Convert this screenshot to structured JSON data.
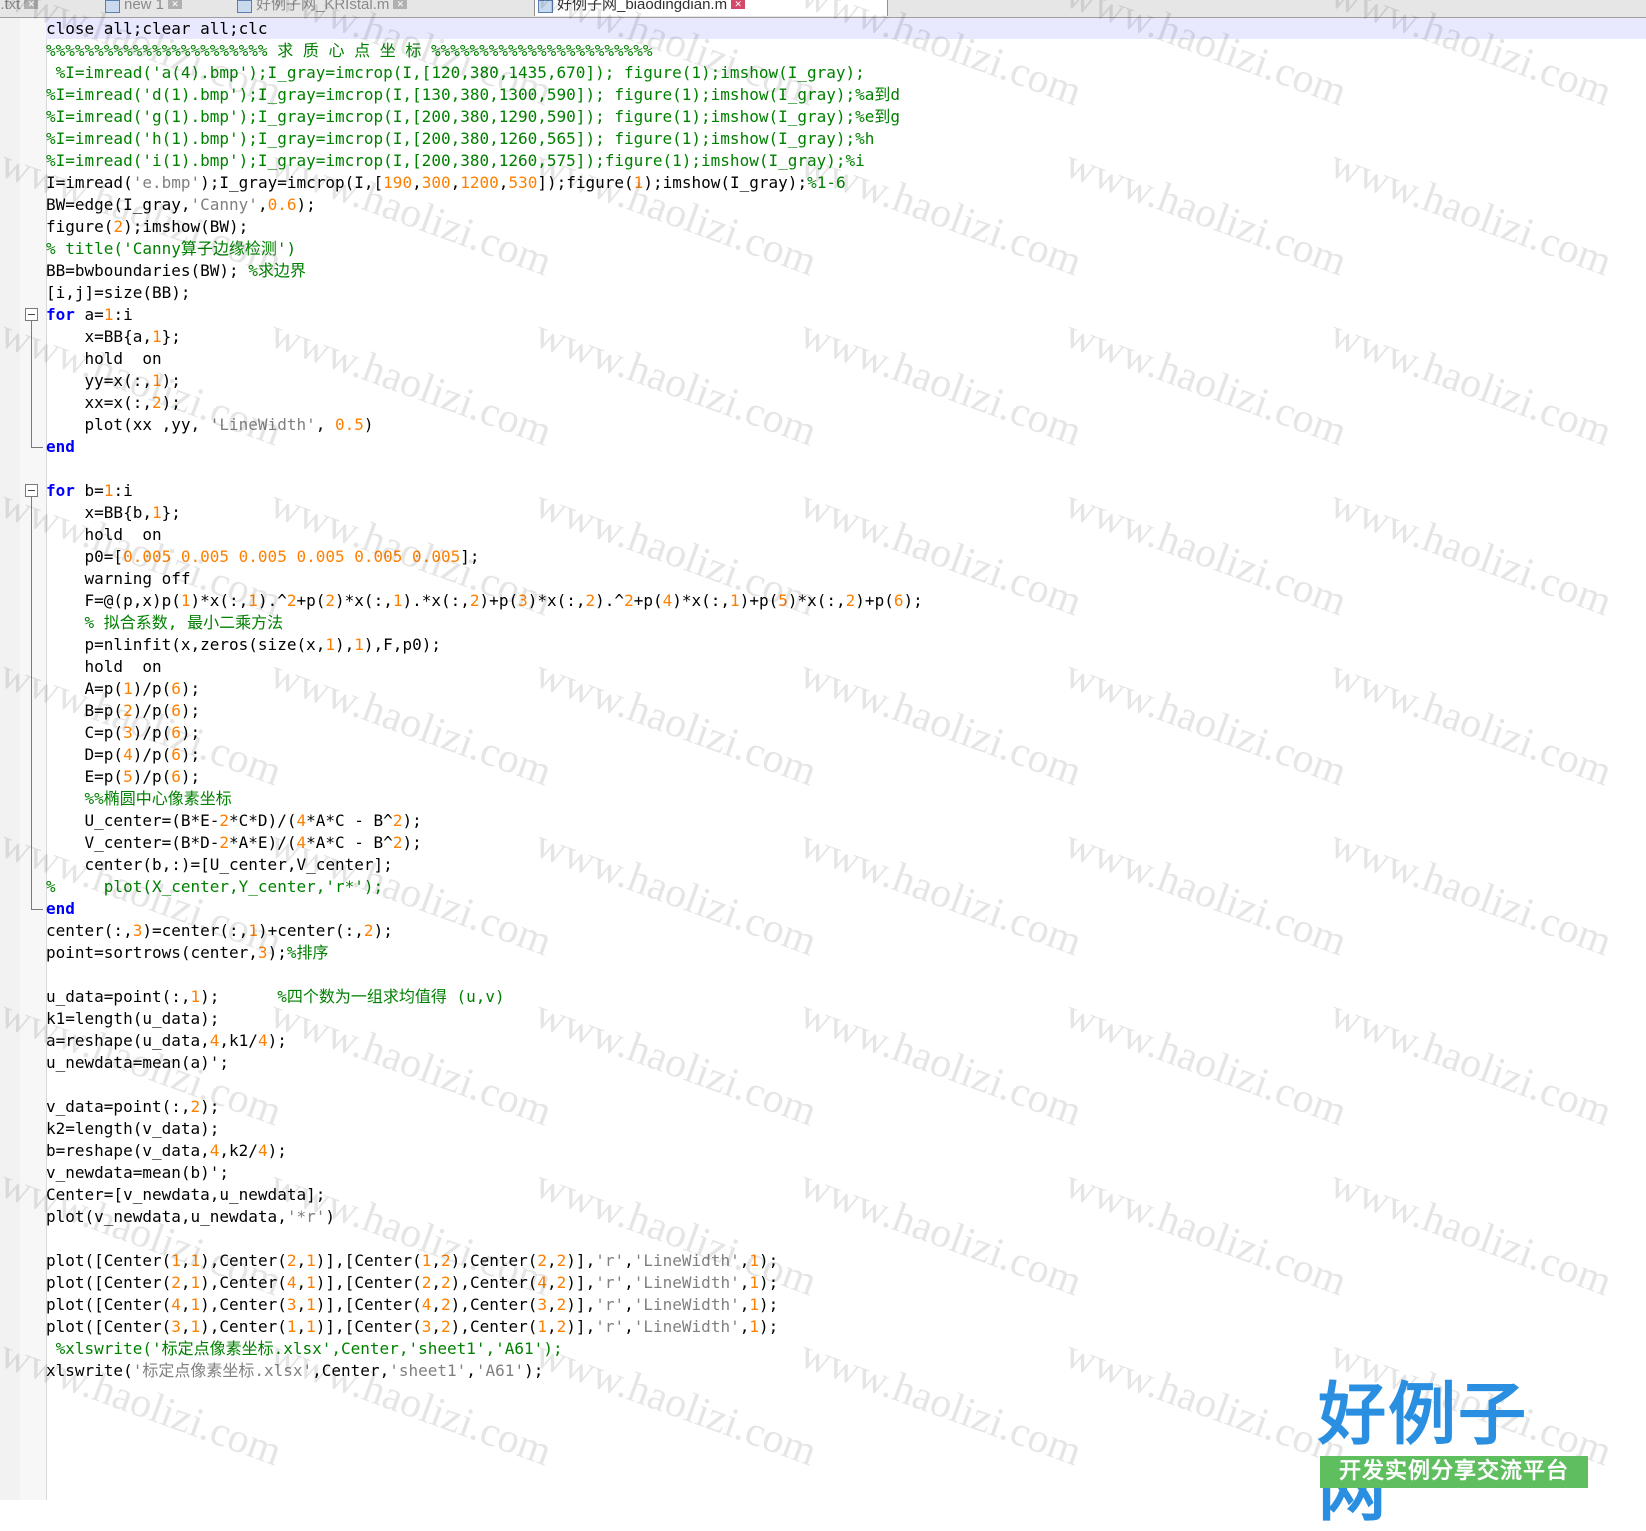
{
  "tabs": [
    {
      "label": "b.txt",
      "active": false
    },
    {
      "label": "new  1",
      "active": false
    },
    {
      "label": "好例子网_KRIstal.m",
      "active": false
    },
    {
      "label": "好例子网_biaodingdian.m",
      "active": true
    }
  ],
  "code_lines": [
    [
      {
        "t": "",
        "v": "close all;clear all;clc"
      }
    ],
    [
      {
        "t": "c",
        "v": "%%%%%%%%%%%%%%%%%%%%%%% 求 质 心 点 坐 标 %%%%%%%%%%%%%%%%%%%%%%%"
      }
    ],
    [
      {
        "t": "c",
        "v": " %I=imread('a(4).bmp');I_gray=imcrop(I,[120,380,1435,670]); figure(1);imshow(I_gray);"
      }
    ],
    [
      {
        "t": "c",
        "v": "%I=imread('d(1).bmp');I_gray=imcrop(I,[130,380,1300,590]); figure(1);imshow(I_gray);%a到d"
      }
    ],
    [
      {
        "t": "c",
        "v": "%I=imread('g(1).bmp');I_gray=imcrop(I,[200,380,1290,590]); figure(1);imshow(I_gray);%e到g"
      }
    ],
    [
      {
        "t": "c",
        "v": "%I=imread('h(1).bmp');I_gray=imcrop(I,[200,380,1260,565]); figure(1);imshow(I_gray);%h"
      }
    ],
    [
      {
        "t": "c",
        "v": "%I=imread('i(1).bmp');I_gray=imcrop(I,[200,380,1260,575]);figure(1);imshow(I_gray);%i"
      }
    ],
    [
      {
        "t": "",
        "v": "I=imread("
      },
      {
        "t": "s",
        "v": "'e.bmp'"
      },
      {
        "t": "",
        "v": ");I_gray=imcrop(I,["
      },
      {
        "t": "n",
        "v": "190"
      },
      {
        "t": "",
        "v": ","
      },
      {
        "t": "n",
        "v": "300"
      },
      {
        "t": "",
        "v": ","
      },
      {
        "t": "n",
        "v": "1200"
      },
      {
        "t": "",
        "v": ","
      },
      {
        "t": "n",
        "v": "530"
      },
      {
        "t": "",
        "v": "]);figure("
      },
      {
        "t": "n",
        "v": "1"
      },
      {
        "t": "",
        "v": ");imshow(I_gray);"
      },
      {
        "t": "c",
        "v": "%1-6"
      }
    ],
    [
      {
        "t": "",
        "v": "BW=edge(I_gray,"
      },
      {
        "t": "s",
        "v": "'Canny'"
      },
      {
        "t": "",
        "v": ","
      },
      {
        "t": "n",
        "v": "0.6"
      },
      {
        "t": "",
        "v": ");"
      }
    ],
    [
      {
        "t": "",
        "v": "figure("
      },
      {
        "t": "n",
        "v": "2"
      },
      {
        "t": "",
        "v": ");imshow(BW);"
      }
    ],
    [
      {
        "t": "c",
        "v": "% title('Canny算子边缘检测')"
      }
    ],
    [
      {
        "t": "",
        "v": "BB=bwboundaries(BW); "
      },
      {
        "t": "c",
        "v": "%求边界"
      }
    ],
    [
      {
        "t": "",
        "v": "[i,j]=size(BB);"
      }
    ],
    [
      {
        "t": "k",
        "v": "for"
      },
      {
        "t": "",
        "v": " a="
      },
      {
        "t": "n",
        "v": "1"
      },
      {
        "t": "",
        "v": ":i"
      }
    ],
    [
      {
        "t": "",
        "v": "    x=BB{a,"
      },
      {
        "t": "n",
        "v": "1"
      },
      {
        "t": "",
        "v": "};"
      }
    ],
    [
      {
        "t": "",
        "v": "    hold  on"
      }
    ],
    [
      {
        "t": "",
        "v": "    yy=x(:,"
      },
      {
        "t": "n",
        "v": "1"
      },
      {
        "t": "",
        "v": ");"
      }
    ],
    [
      {
        "t": "",
        "v": "    xx=x(:,"
      },
      {
        "t": "n",
        "v": "2"
      },
      {
        "t": "",
        "v": ");"
      }
    ],
    [
      {
        "t": "",
        "v": "    plot(xx ,yy, "
      },
      {
        "t": "s",
        "v": "'LineWidth'"
      },
      {
        "t": "",
        "v": ", "
      },
      {
        "t": "n",
        "v": "0.5"
      },
      {
        "t": "",
        "v": ")"
      }
    ],
    [
      {
        "t": "k",
        "v": "end"
      }
    ],
    [
      {
        "t": "",
        "v": ""
      }
    ],
    [
      {
        "t": "k",
        "v": "for"
      },
      {
        "t": "",
        "v": " b="
      },
      {
        "t": "n",
        "v": "1"
      },
      {
        "t": "",
        "v": ":i"
      }
    ],
    [
      {
        "t": "",
        "v": "    x=BB{b,"
      },
      {
        "t": "n",
        "v": "1"
      },
      {
        "t": "",
        "v": "};"
      }
    ],
    [
      {
        "t": "",
        "v": "    hold  on"
      }
    ],
    [
      {
        "t": "",
        "v": "    p0=["
      },
      {
        "t": "n",
        "v": "0.005 0.005 0.005 0.005 0.005 0.005"
      },
      {
        "t": "",
        "v": "];"
      }
    ],
    [
      {
        "t": "",
        "v": "    warning off"
      }
    ],
    [
      {
        "t": "",
        "v": "    F=@(p,x)p("
      },
      {
        "t": "n",
        "v": "1"
      },
      {
        "t": "",
        "v": ")*x(:,"
      },
      {
        "t": "n",
        "v": "1"
      },
      {
        "t": "",
        "v": ").^"
      },
      {
        "t": "n",
        "v": "2"
      },
      {
        "t": "",
        "v": "+p("
      },
      {
        "t": "n",
        "v": "2"
      },
      {
        "t": "",
        "v": ")*x(:,"
      },
      {
        "t": "n",
        "v": "1"
      },
      {
        "t": "",
        "v": ").*x(:,"
      },
      {
        "t": "n",
        "v": "2"
      },
      {
        "t": "",
        "v": ")+p("
      },
      {
        "t": "n",
        "v": "3"
      },
      {
        "t": "",
        "v": ")*x(:,"
      },
      {
        "t": "n",
        "v": "2"
      },
      {
        "t": "",
        "v": ").^"
      },
      {
        "t": "n",
        "v": "2"
      },
      {
        "t": "",
        "v": "+p("
      },
      {
        "t": "n",
        "v": "4"
      },
      {
        "t": "",
        "v": ")*x(:,"
      },
      {
        "t": "n",
        "v": "1"
      },
      {
        "t": "",
        "v": ")+p("
      },
      {
        "t": "n",
        "v": "5"
      },
      {
        "t": "",
        "v": ")*x(:,"
      },
      {
        "t": "n",
        "v": "2"
      },
      {
        "t": "",
        "v": ")+p("
      },
      {
        "t": "n",
        "v": "6"
      },
      {
        "t": "",
        "v": ");"
      }
    ],
    [
      {
        "t": "",
        "v": "    "
      },
      {
        "t": "c",
        "v": "% 拟合系数, 最小二乘方法"
      }
    ],
    [
      {
        "t": "",
        "v": "    p=nlinfit(x,zeros(size(x,"
      },
      {
        "t": "n",
        "v": "1"
      },
      {
        "t": "",
        "v": "),"
      },
      {
        "t": "n",
        "v": "1"
      },
      {
        "t": "",
        "v": "),F,p0);"
      }
    ],
    [
      {
        "t": "",
        "v": "    hold  on"
      }
    ],
    [
      {
        "t": "",
        "v": "    A=p("
      },
      {
        "t": "n",
        "v": "1"
      },
      {
        "t": "",
        "v": ")/p("
      },
      {
        "t": "n",
        "v": "6"
      },
      {
        "t": "",
        "v": ");"
      }
    ],
    [
      {
        "t": "",
        "v": "    B=p("
      },
      {
        "t": "n",
        "v": "2"
      },
      {
        "t": "",
        "v": ")/p("
      },
      {
        "t": "n",
        "v": "6"
      },
      {
        "t": "",
        "v": ");"
      }
    ],
    [
      {
        "t": "",
        "v": "    C=p("
      },
      {
        "t": "n",
        "v": "3"
      },
      {
        "t": "",
        "v": ")/p("
      },
      {
        "t": "n",
        "v": "6"
      },
      {
        "t": "",
        "v": ");"
      }
    ],
    [
      {
        "t": "",
        "v": "    D=p("
      },
      {
        "t": "n",
        "v": "4"
      },
      {
        "t": "",
        "v": ")/p("
      },
      {
        "t": "n",
        "v": "6"
      },
      {
        "t": "",
        "v": ");"
      }
    ],
    [
      {
        "t": "",
        "v": "    E=p("
      },
      {
        "t": "n",
        "v": "5"
      },
      {
        "t": "",
        "v": ")/p("
      },
      {
        "t": "n",
        "v": "6"
      },
      {
        "t": "",
        "v": ");"
      }
    ],
    [
      {
        "t": "",
        "v": "    "
      },
      {
        "t": "c",
        "v": "%%椭圆中心像素坐标"
      }
    ],
    [
      {
        "t": "",
        "v": "    U_center=(B*E-"
      },
      {
        "t": "n",
        "v": "2"
      },
      {
        "t": "",
        "v": "*C*D)/("
      },
      {
        "t": "n",
        "v": "4"
      },
      {
        "t": "",
        "v": "*A*C - B^"
      },
      {
        "t": "n",
        "v": "2"
      },
      {
        "t": "",
        "v": ");"
      }
    ],
    [
      {
        "t": "",
        "v": "    V_center=(B*D-"
      },
      {
        "t": "n",
        "v": "2"
      },
      {
        "t": "",
        "v": "*A*E)/("
      },
      {
        "t": "n",
        "v": "4"
      },
      {
        "t": "",
        "v": "*A*C - B^"
      },
      {
        "t": "n",
        "v": "2"
      },
      {
        "t": "",
        "v": ");"
      }
    ],
    [
      {
        "t": "",
        "v": "    center(b,:)=[U_center,V_center];"
      }
    ],
    [
      {
        "t": "c",
        "v": "%     plot(X_center,Y_center,'r*');"
      }
    ],
    [
      {
        "t": "k",
        "v": "end"
      }
    ],
    [
      {
        "t": "",
        "v": "center(:,"
      },
      {
        "t": "n",
        "v": "3"
      },
      {
        "t": "",
        "v": ")=center(:,"
      },
      {
        "t": "n",
        "v": "1"
      },
      {
        "t": "",
        "v": ")+center(:,"
      },
      {
        "t": "n",
        "v": "2"
      },
      {
        "t": "",
        "v": ");"
      }
    ],
    [
      {
        "t": "",
        "v": "point=sortrows(center,"
      },
      {
        "t": "n",
        "v": "3"
      },
      {
        "t": "",
        "v": ");"
      },
      {
        "t": "c",
        "v": "%排序"
      }
    ],
    [
      {
        "t": "",
        "v": ""
      }
    ],
    [
      {
        "t": "",
        "v": "u_data=point(:,"
      },
      {
        "t": "n",
        "v": "1"
      },
      {
        "t": "",
        "v": ");      "
      },
      {
        "t": "c",
        "v": "%四个数为一组求均值得 (u,v)"
      }
    ],
    [
      {
        "t": "",
        "v": "k1=length(u_data);"
      }
    ],
    [
      {
        "t": "",
        "v": "a=reshape(u_data,"
      },
      {
        "t": "n",
        "v": "4"
      },
      {
        "t": "",
        "v": ",k1/"
      },
      {
        "t": "n",
        "v": "4"
      },
      {
        "t": "",
        "v": ");"
      }
    ],
    [
      {
        "t": "",
        "v": "u_newdata=mean(a)';"
      }
    ],
    [
      {
        "t": "",
        "v": ""
      }
    ],
    [
      {
        "t": "",
        "v": "v_data=point(:,"
      },
      {
        "t": "n",
        "v": "2"
      },
      {
        "t": "",
        "v": ");"
      }
    ],
    [
      {
        "t": "",
        "v": "k2=length(v_data);"
      }
    ],
    [
      {
        "t": "",
        "v": "b=reshape(v_data,"
      },
      {
        "t": "n",
        "v": "4"
      },
      {
        "t": "",
        "v": ",k2/"
      },
      {
        "t": "n",
        "v": "4"
      },
      {
        "t": "",
        "v": ");"
      }
    ],
    [
      {
        "t": "",
        "v": "v_newdata=mean(b)';"
      }
    ],
    [
      {
        "t": "",
        "v": "Center=[v_newdata,u_newdata];"
      }
    ],
    [
      {
        "t": "",
        "v": "plot(v_newdata,u_newdata,"
      },
      {
        "t": "s",
        "v": "'*r'"
      },
      {
        "t": "",
        "v": ")"
      }
    ],
    [
      {
        "t": "",
        "v": ""
      }
    ],
    [
      {
        "t": "",
        "v": "plot([Center("
      },
      {
        "t": "n",
        "v": "1"
      },
      {
        "t": "",
        "v": ","
      },
      {
        "t": "n",
        "v": "1"
      },
      {
        "t": "",
        "v": "),Center("
      },
      {
        "t": "n",
        "v": "2"
      },
      {
        "t": "",
        "v": ","
      },
      {
        "t": "n",
        "v": "1"
      },
      {
        "t": "",
        "v": ")],[Center("
      },
      {
        "t": "n",
        "v": "1"
      },
      {
        "t": "",
        "v": ","
      },
      {
        "t": "n",
        "v": "2"
      },
      {
        "t": "",
        "v": "),Center("
      },
      {
        "t": "n",
        "v": "2"
      },
      {
        "t": "",
        "v": ","
      },
      {
        "t": "n",
        "v": "2"
      },
      {
        "t": "",
        "v": ")],"
      },
      {
        "t": "s",
        "v": "'r'"
      },
      {
        "t": "",
        "v": ","
      },
      {
        "t": "s",
        "v": "'LineWidth'"
      },
      {
        "t": "",
        "v": ","
      },
      {
        "t": "n",
        "v": "1"
      },
      {
        "t": "",
        "v": ");"
      }
    ],
    [
      {
        "t": "",
        "v": "plot([Center("
      },
      {
        "t": "n",
        "v": "2"
      },
      {
        "t": "",
        "v": ","
      },
      {
        "t": "n",
        "v": "1"
      },
      {
        "t": "",
        "v": "),Center("
      },
      {
        "t": "n",
        "v": "4"
      },
      {
        "t": "",
        "v": ","
      },
      {
        "t": "n",
        "v": "1"
      },
      {
        "t": "",
        "v": ")],[Center("
      },
      {
        "t": "n",
        "v": "2"
      },
      {
        "t": "",
        "v": ","
      },
      {
        "t": "n",
        "v": "2"
      },
      {
        "t": "",
        "v": "),Center("
      },
      {
        "t": "n",
        "v": "4"
      },
      {
        "t": "",
        "v": ","
      },
      {
        "t": "n",
        "v": "2"
      },
      {
        "t": "",
        "v": ")],"
      },
      {
        "t": "s",
        "v": "'r'"
      },
      {
        "t": "",
        "v": ","
      },
      {
        "t": "s",
        "v": "'LineWidth'"
      },
      {
        "t": "",
        "v": ","
      },
      {
        "t": "n",
        "v": "1"
      },
      {
        "t": "",
        "v": ");"
      }
    ],
    [
      {
        "t": "",
        "v": "plot([Center("
      },
      {
        "t": "n",
        "v": "4"
      },
      {
        "t": "",
        "v": ","
      },
      {
        "t": "n",
        "v": "1"
      },
      {
        "t": "",
        "v": "),Center("
      },
      {
        "t": "n",
        "v": "3"
      },
      {
        "t": "",
        "v": ","
      },
      {
        "t": "n",
        "v": "1"
      },
      {
        "t": "",
        "v": ")],[Center("
      },
      {
        "t": "n",
        "v": "4"
      },
      {
        "t": "",
        "v": ","
      },
      {
        "t": "n",
        "v": "2"
      },
      {
        "t": "",
        "v": "),Center("
      },
      {
        "t": "n",
        "v": "3"
      },
      {
        "t": "",
        "v": ","
      },
      {
        "t": "n",
        "v": "2"
      },
      {
        "t": "",
        "v": ")],"
      },
      {
        "t": "s",
        "v": "'r'"
      },
      {
        "t": "",
        "v": ","
      },
      {
        "t": "s",
        "v": "'LineWidth'"
      },
      {
        "t": "",
        "v": ","
      },
      {
        "t": "n",
        "v": "1"
      },
      {
        "t": "",
        "v": ");"
      }
    ],
    [
      {
        "t": "",
        "v": "plot([Center("
      },
      {
        "t": "n",
        "v": "3"
      },
      {
        "t": "",
        "v": ","
      },
      {
        "t": "n",
        "v": "1"
      },
      {
        "t": "",
        "v": "),Center("
      },
      {
        "t": "n",
        "v": "1"
      },
      {
        "t": "",
        "v": ","
      },
      {
        "t": "n",
        "v": "1"
      },
      {
        "t": "",
        "v": ")],[Center("
      },
      {
        "t": "n",
        "v": "3"
      },
      {
        "t": "",
        "v": ","
      },
      {
        "t": "n",
        "v": "2"
      },
      {
        "t": "",
        "v": "),Center("
      },
      {
        "t": "n",
        "v": "1"
      },
      {
        "t": "",
        "v": ","
      },
      {
        "t": "n",
        "v": "2"
      },
      {
        "t": "",
        "v": ")],"
      },
      {
        "t": "s",
        "v": "'r'"
      },
      {
        "t": "",
        "v": ","
      },
      {
        "t": "s",
        "v": "'LineWidth'"
      },
      {
        "t": "",
        "v": ","
      },
      {
        "t": "n",
        "v": "1"
      },
      {
        "t": "",
        "v": ");"
      }
    ],
    [
      {
        "t": "c",
        "v": " %xlswrite('标定点像素坐标.xlsx',Center,'sheet1','A61');"
      }
    ],
    [
      {
        "t": "",
        "v": "xlswrite("
      },
      {
        "t": "s",
        "v": "'标定点像素坐标.xlsx'"
      },
      {
        "t": "",
        "v": ",Center,"
      },
      {
        "t": "s",
        "v": "'sheet1'"
      },
      {
        "t": "",
        "v": ","
      },
      {
        "t": "s",
        "v": "'A61'"
      },
      {
        "t": "",
        "v": ");"
      }
    ]
  ],
  "watermark_text": "www.haolizi.com",
  "logo": {
    "title": "好例子网",
    "subtitle": "开发实例分享交流平台"
  },
  "colors": {
    "keyword": "#0000ff",
    "comment": "#008000",
    "string": "#808080",
    "number": "#ff8000",
    "current_line": "#e8e8ff",
    "logo_blue": "#2a8fe0",
    "logo_green": "#5fbf5f"
  }
}
